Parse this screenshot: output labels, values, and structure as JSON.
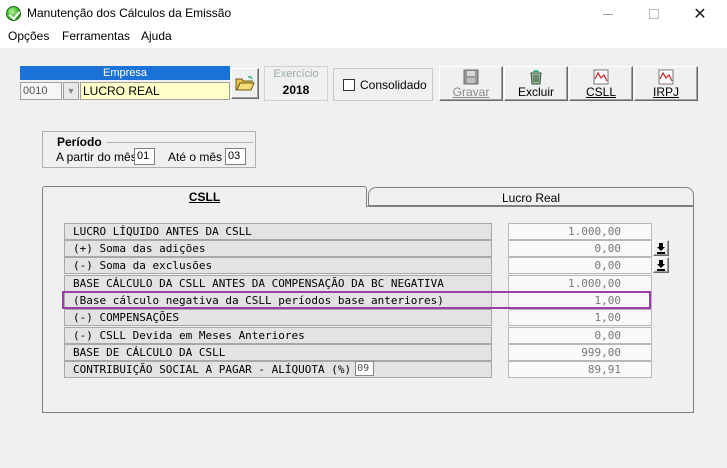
{
  "window": {
    "title": "Manutenção dos Cálculos da Emissão",
    "close_glyph": "✕"
  },
  "menu": {
    "items": [
      "Opções",
      "Ferramentas",
      "Ajuda"
    ]
  },
  "empresa": {
    "label": "Empresa",
    "code": "0010",
    "name": "LUCRO REAL"
  },
  "exercicio": {
    "label": "Exercício",
    "value": "2018"
  },
  "consolidado": {
    "label": "Consolidado",
    "checked": false
  },
  "toolbar": {
    "gravar": "Gravar",
    "excluir": "Excluir",
    "csll": "CSLL",
    "irpj": "IRPJ"
  },
  "periodo": {
    "title": "Período",
    "from_label": "A partir do mês",
    "from_value": "01",
    "to_label": "Até o mês",
    "to_value": "03"
  },
  "tabs": {
    "csll": "CSLL",
    "lucro_real": "Lucro Real"
  },
  "rows": [
    {
      "label": "LUCRO LÍQUIDO ANTES DA CSLL",
      "value": "1.000,00"
    },
    {
      "label": "(+) Soma das adições",
      "value": "0,00"
    },
    {
      "label": "(-) Soma da exclusões",
      "value": "0,00"
    },
    {
      "label": "BASE CÁLCULO DA CSLL ANTES DA COMPENSAÇÃO DA BC NEGATIVA",
      "value": "1.000,00"
    },
    {
      "label": "(Base cálculo negativa da CSLL períodos base anteriores)",
      "value": "1,00"
    },
    {
      "label": "(-) COMPENSAÇÕES",
      "value": "1,00"
    },
    {
      "label": "(-) CSLL Devida em Meses Anteriores",
      "value": "0,00"
    },
    {
      "label": "BASE DE CÁLCULO DA CSLL",
      "value": "999,00"
    },
    {
      "label": "CONTRIBUIÇÃO SOCIAL A PAGAR - ALÍQUOTA (%)",
      "value": "89,91",
      "aliquota": "09"
    }
  ],
  "colors": {
    "accent_blue": "#1a72d6",
    "highlight_purple": "#9b3fa8",
    "field_yellow": "#ffffc8"
  }
}
